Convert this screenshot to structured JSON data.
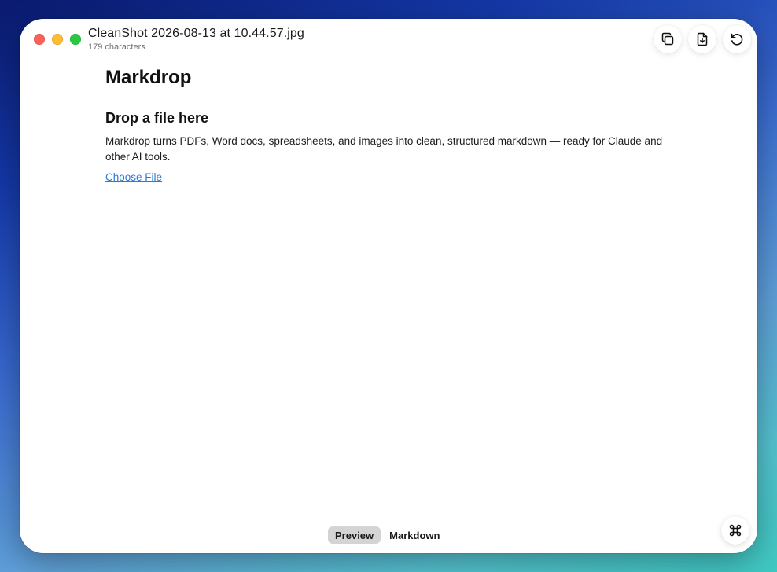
{
  "window": {
    "title": "CleanShot 2026-08-13 at 10.44.57.jpg",
    "subtitle": "179 characters"
  },
  "toolbar": {
    "copy_icon": "copy-icon",
    "download_icon": "download-file-icon",
    "reset_icon": "reset-icon"
  },
  "content": {
    "app_title": "Markdrop",
    "drop_heading": "Drop a file here",
    "description": "Markdrop turns PDFs, Word docs, spreadsheets, and images into clean, structured markdown — ready for Claude and other AI tools.",
    "choose_file": "Choose File"
  },
  "view_toggle": {
    "options": [
      "Preview",
      "Markdown"
    ],
    "selected": "Preview"
  },
  "corner": {
    "icon": "command-icon"
  },
  "colors": {
    "link": "#2a7ad6",
    "close": "#fe5f57",
    "minimize": "#febc2e",
    "zoom": "#28c840",
    "segment_active": "#d4d4d4"
  }
}
